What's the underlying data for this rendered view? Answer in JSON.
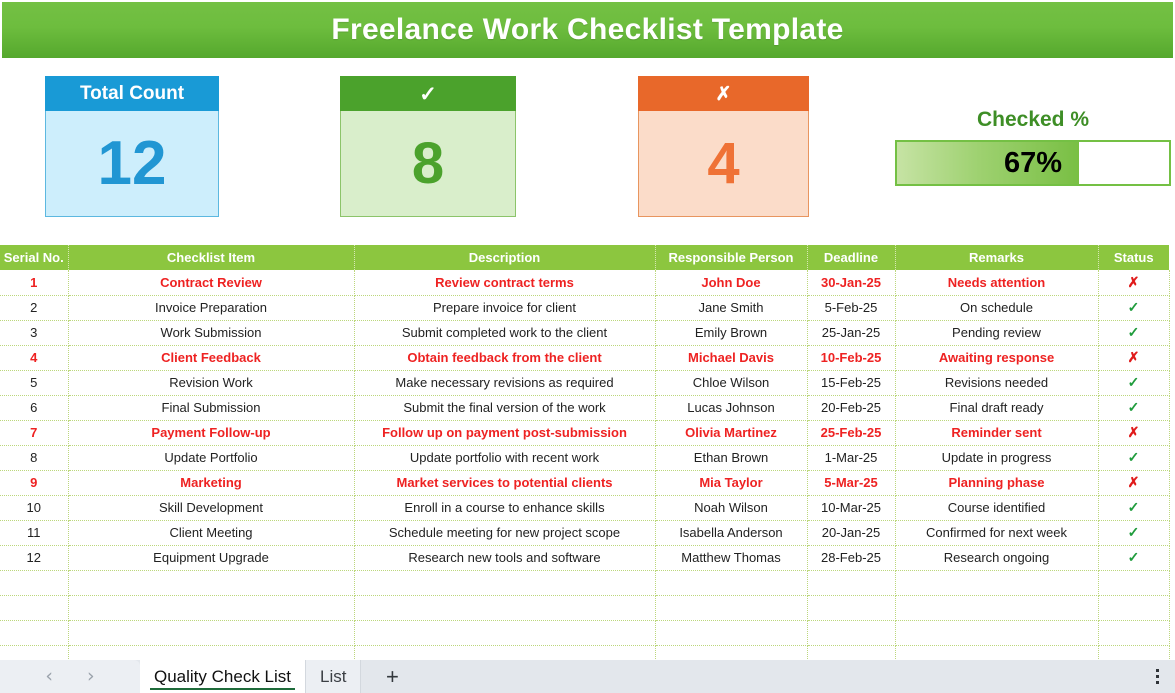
{
  "header": {
    "title": "Freelance Work Checklist Template"
  },
  "kpis": {
    "total": {
      "label": "Total Count",
      "value": "12",
      "color": "#199ad6"
    },
    "checked": {
      "label": "✓",
      "value": "8",
      "color": "#4ba22c"
    },
    "unchecked": {
      "label": "✗",
      "value": "4",
      "color": "#e8682a"
    }
  },
  "gauge": {
    "label": "Checked %",
    "value": "67%",
    "percent": 67,
    "fill_color": "#79bf44",
    "label_color": "#3e8e26"
  },
  "table": {
    "columns": [
      "Serial No.",
      "Checklist Item",
      "Description",
      "Responsible Person",
      "Deadline",
      "Remarks",
      "Status"
    ],
    "header_bg": "#8cc63f",
    "flag_color": "#ee2222",
    "status_ok_glyph": "✓",
    "status_bad_glyph": "✗",
    "rows": [
      {
        "serial": "1",
        "item": "Contract Review",
        "description": "Review contract terms",
        "person": "John Doe",
        "deadline": "30-Jan-25",
        "remarks": "Needs attention",
        "status": "✗",
        "flagged": true
      },
      {
        "serial": "2",
        "item": "Invoice Preparation",
        "description": "Prepare invoice for client",
        "person": "Jane Smith",
        "deadline": "5-Feb-25",
        "remarks": "On schedule",
        "status": "✓",
        "flagged": false
      },
      {
        "serial": "3",
        "item": "Work Submission",
        "description": "Submit completed work to the client",
        "person": "Emily Brown",
        "deadline": "25-Jan-25",
        "remarks": "Pending review",
        "status": "✓",
        "flagged": false
      },
      {
        "serial": "4",
        "item": "Client Feedback",
        "description": "Obtain feedback from the client",
        "person": "Michael Davis",
        "deadline": "10-Feb-25",
        "remarks": "Awaiting response",
        "status": "✗",
        "flagged": true
      },
      {
        "serial": "5",
        "item": "Revision Work",
        "description": "Make necessary revisions as required",
        "person": "Chloe Wilson",
        "deadline": "15-Feb-25",
        "remarks": "Revisions needed",
        "status": "✓",
        "flagged": false
      },
      {
        "serial": "6",
        "item": "Final Submission",
        "description": "Submit the final version of the work",
        "person": "Lucas Johnson",
        "deadline": "20-Feb-25",
        "remarks": "Final draft ready",
        "status": "✓",
        "flagged": false
      },
      {
        "serial": "7",
        "item": "Payment Follow-up",
        "description": "Follow up on payment post-submission",
        "person": "Olivia Martinez",
        "deadline": "25-Feb-25",
        "remarks": "Reminder sent",
        "status": "✗",
        "flagged": true
      },
      {
        "serial": "8",
        "item": "Update Portfolio",
        "description": "Update portfolio with recent work",
        "person": "Ethan Brown",
        "deadline": "1-Mar-25",
        "remarks": "Update in progress",
        "status": "✓",
        "flagged": false
      },
      {
        "serial": "9",
        "item": "Marketing",
        "description": "Market services to potential clients",
        "person": "Mia Taylor",
        "deadline": "5-Mar-25",
        "remarks": "Planning phase",
        "status": "✗",
        "flagged": true
      },
      {
        "serial": "10",
        "item": "Skill Development",
        "description": "Enroll in a course to enhance skills",
        "person": "Noah Wilson",
        "deadline": "10-Mar-25",
        "remarks": "Course identified",
        "status": "✓",
        "flagged": false
      },
      {
        "serial": "11",
        "item": "Client Meeting",
        "description": "Schedule meeting for new project scope",
        "person": "Isabella Anderson",
        "deadline": "20-Jan-25",
        "remarks": "Confirmed for next week",
        "status": "✓",
        "flagged": false
      },
      {
        "serial": "12",
        "item": "Equipment Upgrade",
        "description": "Research new tools and software",
        "person": "Matthew Thomas",
        "deadline": "28-Feb-25",
        "remarks": "Research ongoing",
        "status": "✓",
        "flagged": false
      },
      {
        "serial": "",
        "item": "",
        "description": "",
        "person": "",
        "deadline": "",
        "remarks": "",
        "status": "",
        "flagged": false
      },
      {
        "serial": "",
        "item": "",
        "description": "",
        "person": "",
        "deadline": "",
        "remarks": "",
        "status": "",
        "flagged": false
      },
      {
        "serial": "",
        "item": "",
        "description": "",
        "person": "",
        "deadline": "",
        "remarks": "",
        "status": "",
        "flagged": false
      },
      {
        "serial": "",
        "item": "",
        "description": "",
        "person": "",
        "deadline": "",
        "remarks": "",
        "status": "",
        "flagged": false
      }
    ]
  },
  "tab_bar": {
    "prev_icon": "‹",
    "next_icon": "›",
    "tabs": [
      {
        "label": "Quality Check List",
        "active": true
      },
      {
        "label": "List",
        "active": false
      }
    ],
    "add_label": "+",
    "menu_icon": "kebab-menu-icon"
  }
}
